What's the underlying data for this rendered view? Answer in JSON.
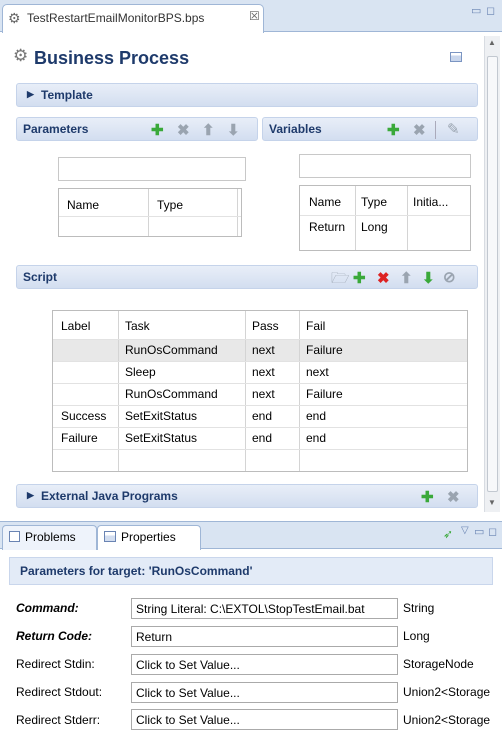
{
  "editor": {
    "tab_title": "TestRestartEmailMonitorBPS.bps",
    "close_symbol": "☒",
    "header_title": "Business Process"
  },
  "sections": {
    "template": "Template",
    "parameters": "Parameters",
    "variables": "Variables",
    "script": "Script",
    "external": "External Java Programs"
  },
  "parameters_table": {
    "columns": [
      "Name",
      "Type"
    ]
  },
  "variables_table": {
    "columns": [
      "Name",
      "Type",
      "Initia..."
    ],
    "rows": [
      [
        "Return",
        "Long",
        ""
      ]
    ]
  },
  "script_table": {
    "columns": [
      "Label",
      "Task",
      "Pass",
      "Fail"
    ],
    "rows": [
      [
        "",
        "RunOsCommand",
        "next",
        "Failure"
      ],
      [
        "",
        "Sleep",
        "next",
        "next"
      ],
      [
        "",
        "RunOsCommand",
        "next",
        "Failure"
      ],
      [
        "Success",
        "SetExitStatus",
        "end",
        "end"
      ],
      [
        "Failure",
        "SetExitStatus",
        "end",
        "end"
      ]
    ]
  },
  "bottom": {
    "tabs": [
      "Problems",
      "Properties"
    ],
    "active_tab": "Properties",
    "panel_title": "Parameters for target: 'RunOsCommand'",
    "properties": [
      {
        "label": "Command:",
        "value": "String Literal: C:\\EXTOL\\StopTestEmail.bat",
        "type": "String",
        "bold": true
      },
      {
        "label": "Return Code:",
        "value": "Return",
        "type": "Long",
        "bold": true
      },
      {
        "label": "Redirect Stdin:",
        "value": "Click to Set Value...",
        "type": "StorageNode",
        "bold": false
      },
      {
        "label": "Redirect Stdout:",
        "value": "Click to Set Value...",
        "type": "Union2<Storage",
        "bold": false
      },
      {
        "label": "Redirect Stderr:",
        "value": "Click to Set Value...",
        "type": "Union2<Storage",
        "bold": false
      }
    ]
  },
  "colors": {
    "accent": "#1e3a6b",
    "add_green": "#3aa93a",
    "delete_red": "#dd2222"
  }
}
